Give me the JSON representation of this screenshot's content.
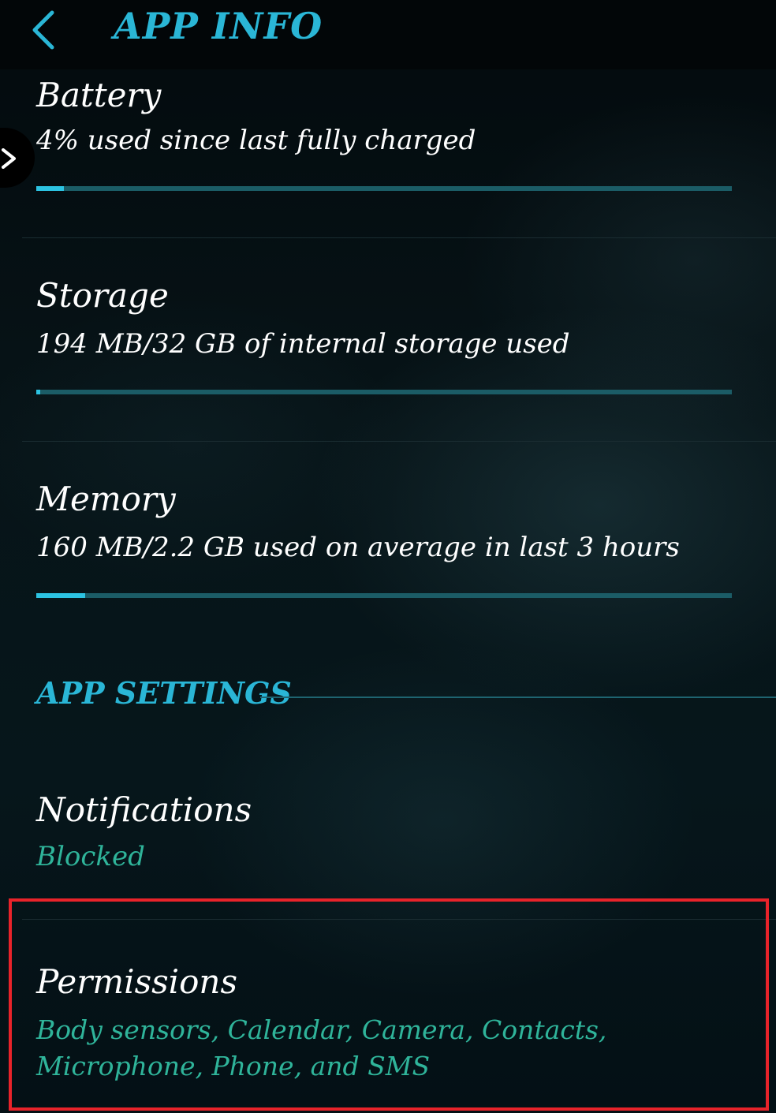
{
  "header": {
    "title": "APP INFO"
  },
  "icons": {
    "back": "chevron-left-icon",
    "side_panel": "chevron-right-icon"
  },
  "colors": {
    "accent": "#2ab6d6",
    "secondary_accent": "#2fb49a",
    "bar_track": "#1b5c66",
    "bar_fill": "#2cc3e2",
    "highlight": "#e8232a",
    "background": "#050e12"
  },
  "usage": {
    "battery": {
      "title": "Battery",
      "summary": "4% used since last fully charged",
      "used_fraction": 0.04
    },
    "storage": {
      "title": "Storage",
      "summary": "194 MB/32 GB of internal storage used",
      "used_fraction": 0.006
    },
    "memory": {
      "title": "Memory",
      "summary": "160 MB/2.2 GB used on average in last 3 hours",
      "used_fraction": 0.07
    }
  },
  "app_settings": {
    "header": "APP SETTINGS",
    "notifications": {
      "title": "Notifications",
      "value": "Blocked"
    },
    "permissions": {
      "title": "Permissions",
      "value_line1": "Body sensors, Calendar, Camera, Contacts,",
      "value_line2": "Microphone, Phone, and SMS"
    }
  }
}
